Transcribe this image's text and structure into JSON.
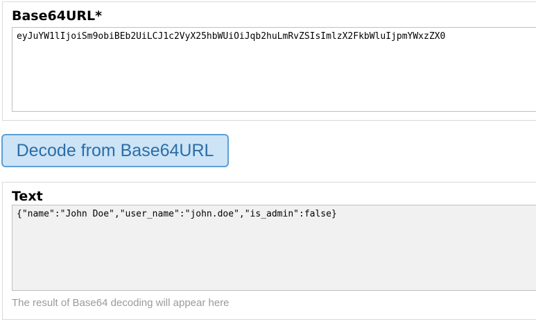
{
  "input_panel": {
    "title": "Base64URL*",
    "value": "eyJuYW1lIjoiSm9obiBEb2UiLCJ1c2VyX25hbWUiOiJqb2huLmRvZSIsImlzX2FkbWluIjpmYWxzZX0"
  },
  "decode_button": {
    "label": "Decode from Base64URL"
  },
  "output_panel": {
    "title": "Text",
    "value": "{\"name\":\"John Doe\",\"user_name\":\"john.doe\",\"is_admin\":false}",
    "hint": "The result of Base64 decoding will appear here"
  }
}
